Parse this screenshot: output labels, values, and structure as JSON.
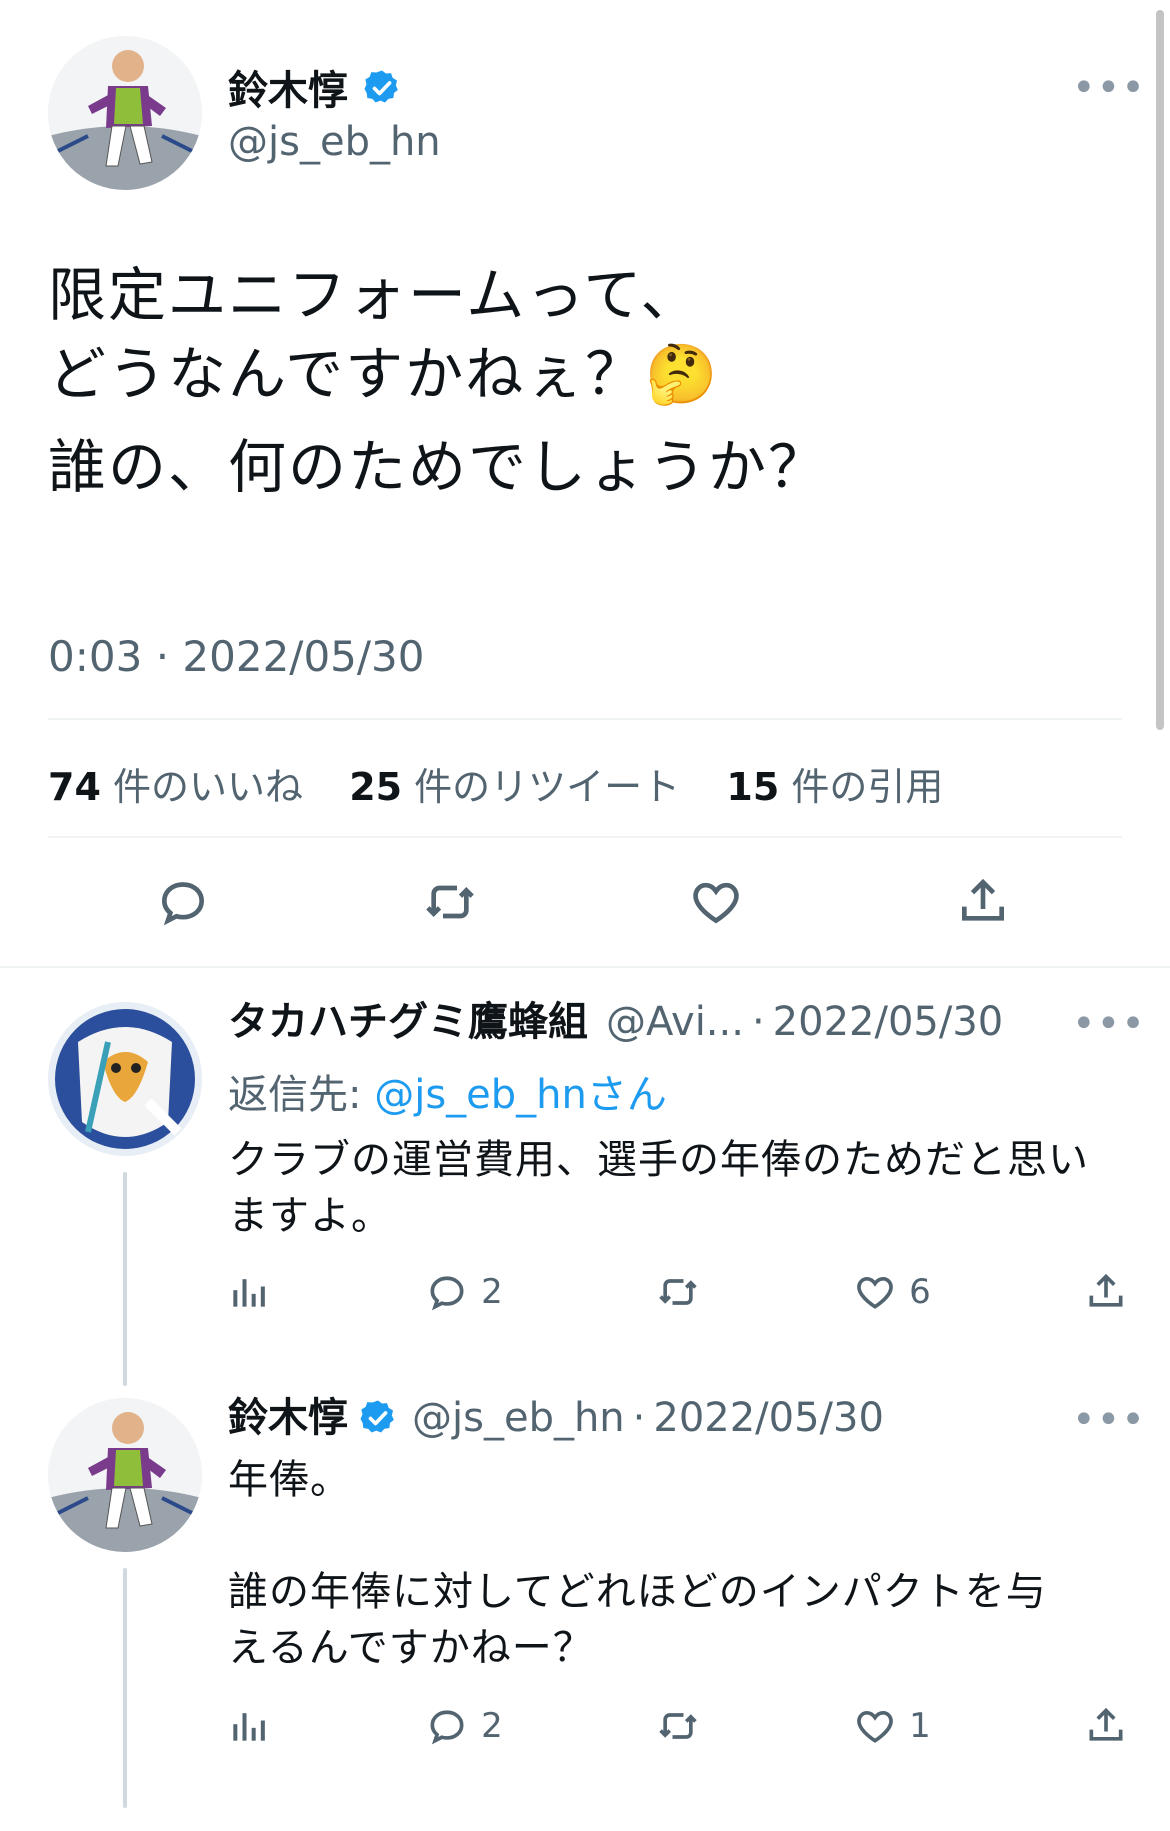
{
  "main_tweet": {
    "author_name": "鈴木惇",
    "author_handle": "@js_eb_hn",
    "text_line1": "限定ユニフォームって、",
    "text_line2": "どうなんですかねぇ？🤔",
    "text_line3": "誰の、何のためでしょうか？",
    "time": "0:03",
    "dot": "·",
    "date": "2022/05/30",
    "more": "•••"
  },
  "stats": {
    "likes_count": "74",
    "likes_label": "件のいいね",
    "retweets_count": "25",
    "retweets_label": "件のリツイート",
    "quotes_count": "15",
    "quotes_label": "件の引用"
  },
  "actions": {
    "reply": "reply-icon",
    "retweet": "retweet-icon",
    "like": "heart-icon",
    "share": "share-icon"
  },
  "replies": [
    {
      "author_name": "タカハチグミ鷹蜂組",
      "author_handle": "@Avi...",
      "dot": "·",
      "date": "2022/05/30",
      "more": "•••",
      "reply_to_prefix": "返信先: ",
      "reply_to_handle": "@js_eb_hnさん",
      "text_line1": "クラブの運営費用、選手の年俸のためだと思い",
      "text_line2": "ますよ。",
      "reply_count": "2",
      "like_count": "6"
    },
    {
      "author_name": "鈴木惇",
      "author_handle": "@js_eb_hn",
      "dot": "·",
      "date": "2022/05/30",
      "more": "•••",
      "text_line1": "年俸。",
      "text_line2": "誰の年俸に対してどれほどのインパクトを与",
      "text_line3": "えるんですかねー？",
      "reply_count": "2",
      "like_count": "1"
    }
  ]
}
